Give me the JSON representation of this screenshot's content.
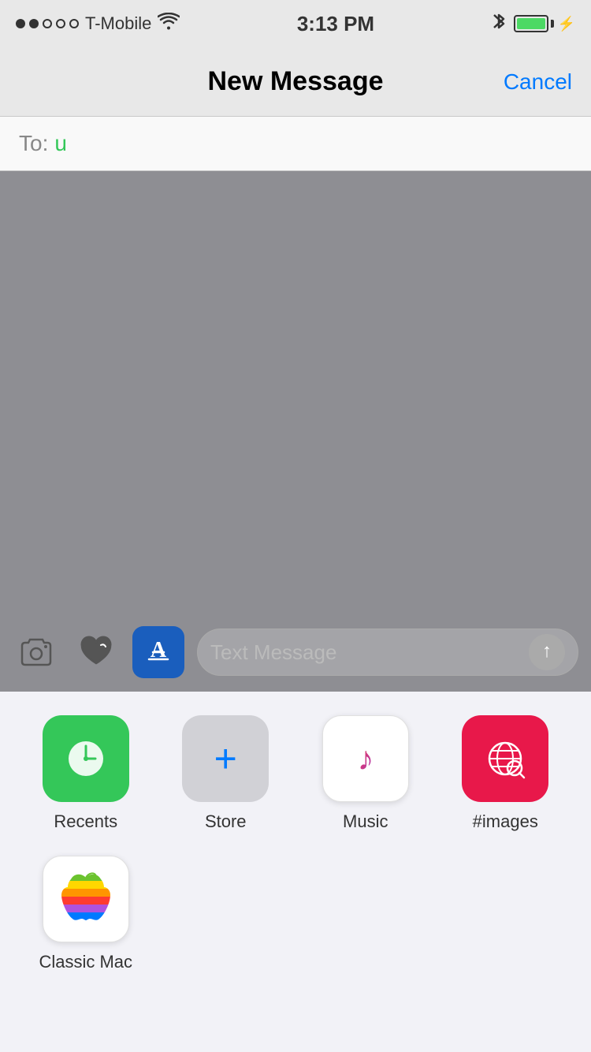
{
  "statusBar": {
    "carrier": "T-Mobile",
    "time": "3:13 PM",
    "wifi": "📶",
    "batteryPercent": 100
  },
  "navBar": {
    "title": "New Message",
    "cancelLabel": "Cancel"
  },
  "toField": {
    "label": "To:",
    "value": "u"
  },
  "toolbar": {
    "textMessagePlaceholder": "Text Message"
  },
  "apps": [
    {
      "id": "recents",
      "label": "Recents",
      "iconType": "clock",
      "bgColor": "green"
    },
    {
      "id": "store",
      "label": "Store",
      "iconType": "plus",
      "bgColor": "gray"
    },
    {
      "id": "music",
      "label": "Music",
      "iconType": "music",
      "bgColor": "white"
    },
    {
      "id": "images",
      "label": "#images",
      "iconType": "globe",
      "bgColor": "red"
    },
    {
      "id": "classicmac",
      "label": "Classic Mac",
      "iconType": "apple",
      "bgColor": "white"
    }
  ]
}
